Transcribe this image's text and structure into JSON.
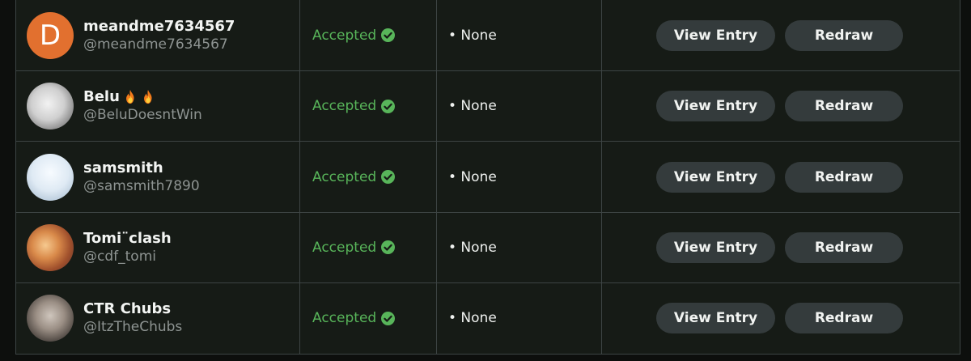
{
  "entries": [
    {
      "display_name": "meandme7634567",
      "handle": "@meandme7634567",
      "avatar_letter": "D",
      "avatar_style": "letter",
      "emojis": [],
      "status": "Accepted",
      "notes": "• None",
      "view_label": "View Entry",
      "redraw_label": "Redraw"
    },
    {
      "display_name": "Belu",
      "handle": "@BeluDoesntWin",
      "avatar_letter": "",
      "avatar_style": "penguin",
      "emojis": [
        "fire-icon",
        "fire-icon"
      ],
      "status": "Accepted",
      "notes": "• None",
      "view_label": "View Entry",
      "redraw_label": "Redraw"
    },
    {
      "display_name": "samsmith",
      "handle": "@samsmith7890",
      "avatar_letter": "",
      "avatar_style": "skate",
      "emojis": [],
      "status": "Accepted",
      "notes": "• None",
      "view_label": "View Entry",
      "redraw_label": "Redraw"
    },
    {
      "display_name": "Tomi¨clash",
      "handle": "@cdf_tomi",
      "avatar_letter": "",
      "avatar_style": "anime",
      "emojis": [],
      "status": "Accepted",
      "notes": "• None",
      "view_label": "View Entry",
      "redraw_label": "Redraw"
    },
    {
      "display_name": "CTR Chubs",
      "handle": "@ItzTheChubs",
      "avatar_letter": "",
      "avatar_style": "person",
      "emojis": [],
      "status": "Accepted",
      "notes": "• None",
      "view_label": "View Entry",
      "redraw_label": "Redraw"
    }
  ],
  "colors": {
    "background": "#0d0f0d",
    "row_background": "#161b16",
    "border": "#3d4444",
    "accepted_green": "#58b55a",
    "button_background": "#343b3c",
    "handle_gray": "#8e9492"
  }
}
